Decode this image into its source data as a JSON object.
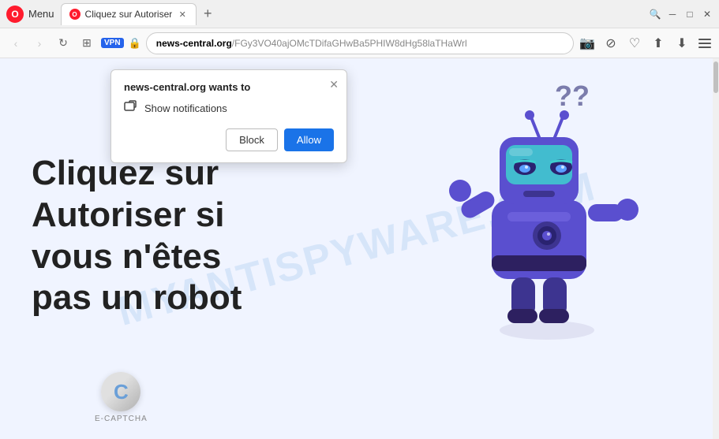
{
  "browser": {
    "title": "Cliquez sur Autoriser",
    "menu_label": "Menu",
    "tab_label": "Cliquez sur Autoriser",
    "new_tab_symbol": "+",
    "url_domain": "news-central.org",
    "url_path": "/FGy3VO40ajOMcTDifaGHwBa5PHIW8dHg58laTHaWrl",
    "vpn_label": "VPN",
    "nav": {
      "back": "‹",
      "forward": "›",
      "refresh": "↻",
      "grid": "⊞"
    },
    "toolbar_icons": [
      "🔍",
      "⊘",
      "♡",
      "⬆",
      "⬇",
      "≡"
    ],
    "win_buttons": [
      "─",
      "□",
      "✕"
    ]
  },
  "popup": {
    "title": "news-central.org wants to",
    "notification_text": "Show notifications",
    "close_symbol": "✕",
    "block_label": "Block",
    "allow_label": "Allow"
  },
  "page": {
    "main_text_line1": "Cliquez sur",
    "main_text_line2": "Autoriser si",
    "main_text_line3": "vous n'êtes",
    "main_text_line4": "pas un robot",
    "watermark": "MYANTISPYWARE.COM",
    "captcha_label": "E-CAPTCHA"
  }
}
